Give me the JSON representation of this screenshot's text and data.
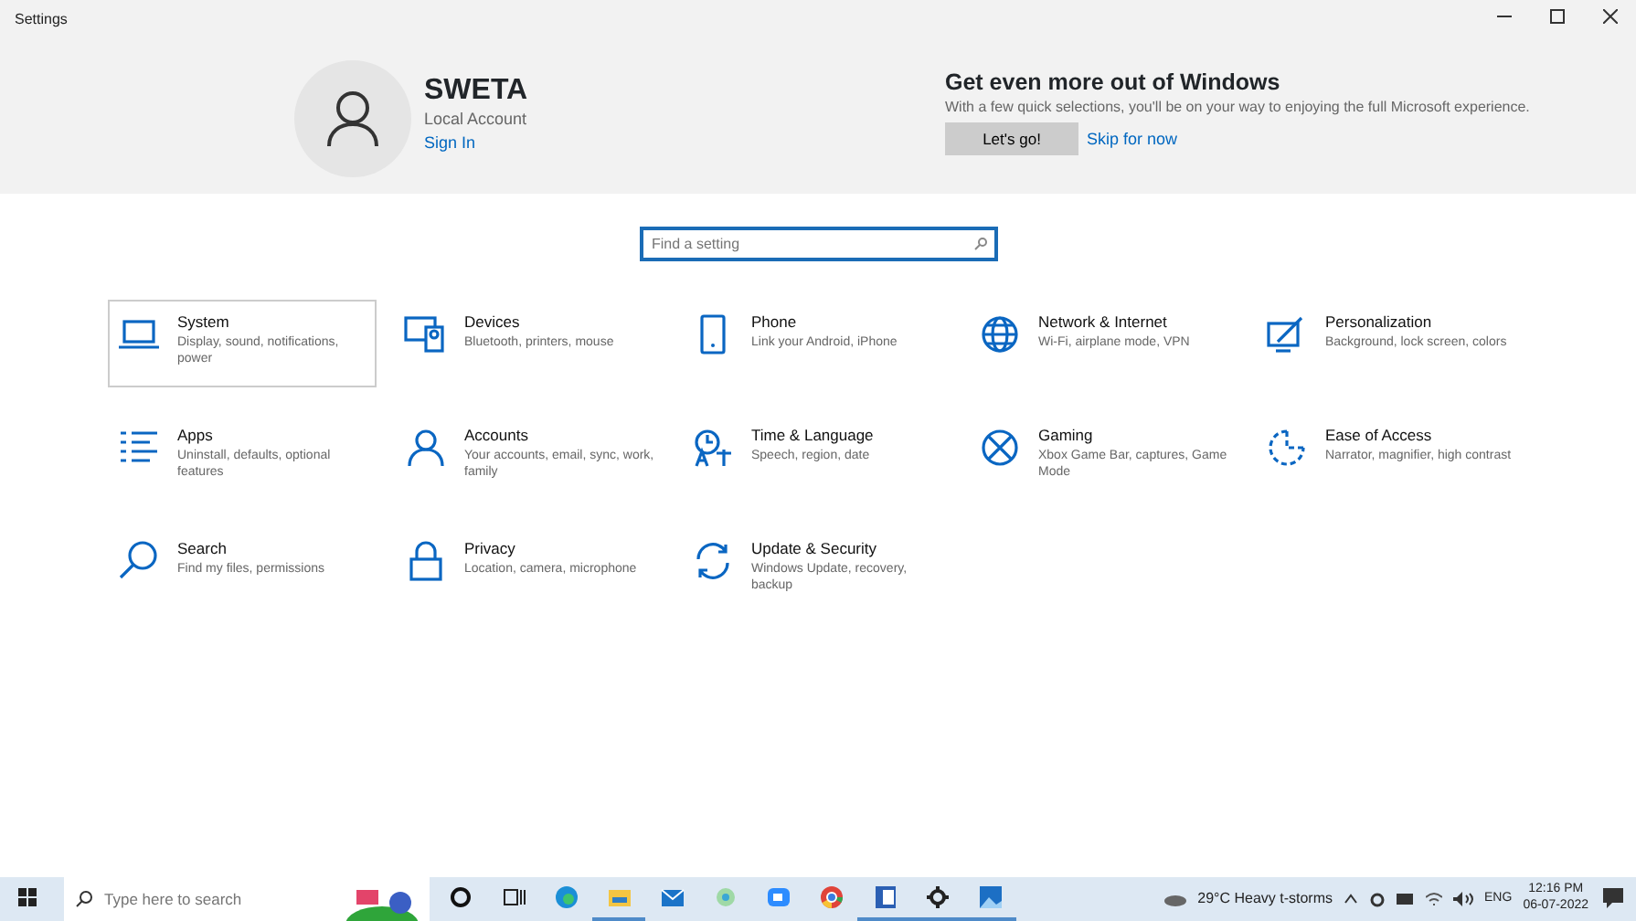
{
  "window": {
    "title": "Settings"
  },
  "account": {
    "name": "SWETA",
    "type": "Local Account",
    "link": "Sign In"
  },
  "promo": {
    "title": "Get even more out of Windows",
    "text": "With a few quick selections, you'll be on your way to enjoying the full Microsoft experience.",
    "primary": "Let's go!",
    "secondary": "Skip for now"
  },
  "search": {
    "placeholder": "Find a setting"
  },
  "categories": [
    {
      "title": "System",
      "subtitle": "Display, sound, notifications, power",
      "selected": true
    },
    {
      "title": "Devices",
      "subtitle": "Bluetooth, printers, mouse",
      "selected": false
    },
    {
      "title": "Phone",
      "subtitle": "Link your Android, iPhone",
      "selected": false
    },
    {
      "title": "Network & Internet",
      "subtitle": "Wi-Fi, airplane mode, VPN",
      "selected": false
    },
    {
      "title": "Personalization",
      "subtitle": "Background, lock screen, colors",
      "selected": false
    },
    {
      "title": "Apps",
      "subtitle": "Uninstall, defaults, optional features",
      "selected": false
    },
    {
      "title": "Accounts",
      "subtitle": "Your accounts, email, sync, work, family",
      "selected": false
    },
    {
      "title": "Time & Language",
      "subtitle": "Speech, region, date",
      "selected": false
    },
    {
      "title": "Gaming",
      "subtitle": "Xbox Game Bar, captures, Game Mode",
      "selected": false
    },
    {
      "title": "Ease of Access",
      "subtitle": "Narrator, magnifier, high contrast",
      "selected": false
    },
    {
      "title": "Search",
      "subtitle": "Find my files, permissions",
      "selected": false
    },
    {
      "title": "Privacy",
      "subtitle": "Location, camera, microphone",
      "selected": false
    },
    {
      "title": "Update & Security",
      "subtitle": "Windows Update, recovery, backup",
      "selected": false
    }
  ],
  "taskbar": {
    "search_placeholder": "Type here to search",
    "apps": [
      {
        "running": false
      },
      {
        "running": true
      },
      {
        "running": false
      },
      {
        "running": false
      },
      {
        "running": false
      },
      {
        "running": false
      },
      {
        "running": true
      },
      {
        "running": true
      },
      {
        "running": true
      }
    ],
    "weather": "29°C  Heavy t-storms",
    "language": "ENG",
    "time": "12:16 PM",
    "date": "06-07-2022"
  }
}
